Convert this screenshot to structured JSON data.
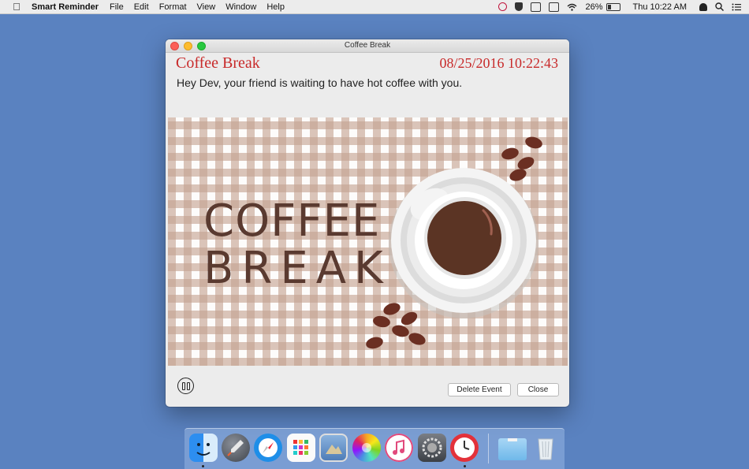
{
  "menubar": {
    "app_name": "Smart Reminder",
    "menus": [
      "File",
      "Edit",
      "Format",
      "View",
      "Window",
      "Help"
    ],
    "battery_percent": "26%",
    "clock": "Thu 10:22 AM"
  },
  "window": {
    "title": "Coffee Break",
    "event_title": "Coffee Break",
    "event_datetime": "08/25/2016 10:22:43",
    "message": "Hey Dev, your friend is waiting to have hot coffee with you.",
    "picture": {
      "line1": "COFFEE",
      "line2": "BREAK"
    },
    "buttons": {
      "delete": "Delete Event",
      "close": "Close"
    }
  },
  "dock": {
    "apps": [
      "finder",
      "launchpad",
      "safari",
      "app-grid",
      "preview",
      "photos",
      "itunes",
      "system-preferences",
      "smart-reminder",
      "downloads-folder",
      "trash"
    ]
  }
}
